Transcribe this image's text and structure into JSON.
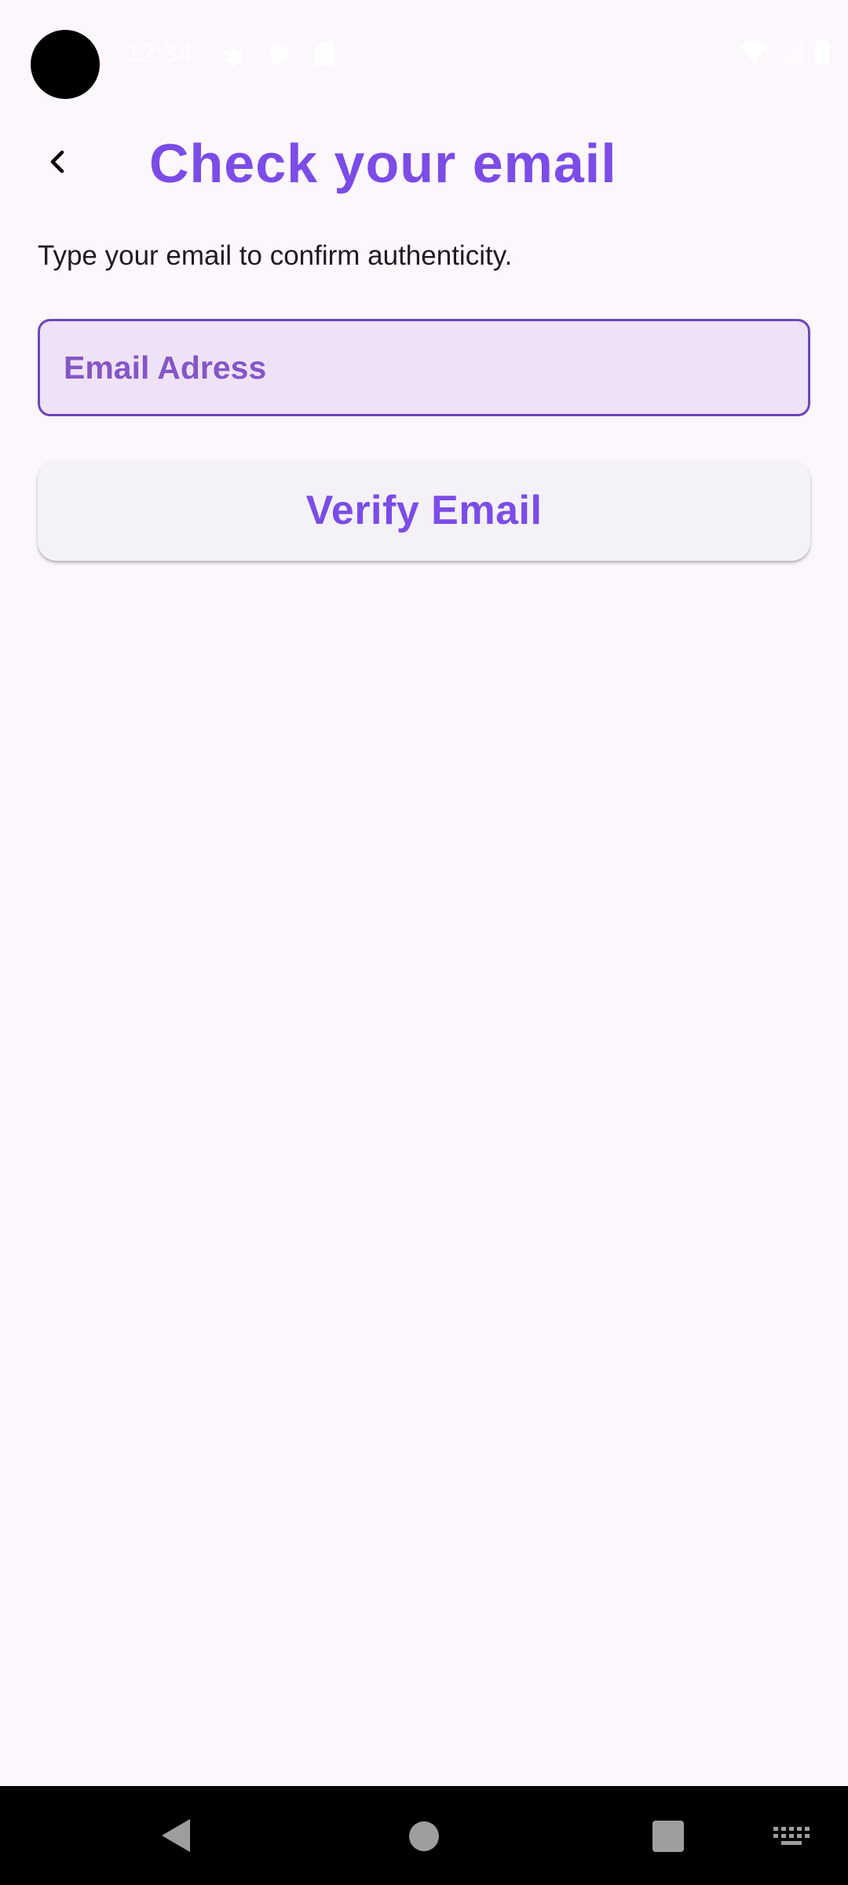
{
  "status_bar": {
    "time": "12:34",
    "left_icons": [
      "settings-icon",
      "shield-icon",
      "sim-card-icon"
    ],
    "right_icons": [
      "wifi-icon",
      "cellular-signal-icon",
      "battery-icon"
    ]
  },
  "header": {
    "back_icon": "chevron-left-icon",
    "title": "Check your email"
  },
  "main": {
    "subtitle": "Type your email to confirm authenticity.",
    "email_field": {
      "value": "",
      "placeholder": "Email Adress"
    },
    "verify_button_label": "Verify Email"
  },
  "nav_bar": {
    "icons": [
      "nav-back-icon",
      "nav-home-icon",
      "nav-recents-icon",
      "keyboard-icon"
    ]
  },
  "colors": {
    "background": "#FDF7FD",
    "accent": "#7B4CE8",
    "field_fill": "#EFE2F6",
    "field_border": "#6B45B8",
    "button_fill": "#F5F1F8",
    "nav_bar": "#000000"
  }
}
